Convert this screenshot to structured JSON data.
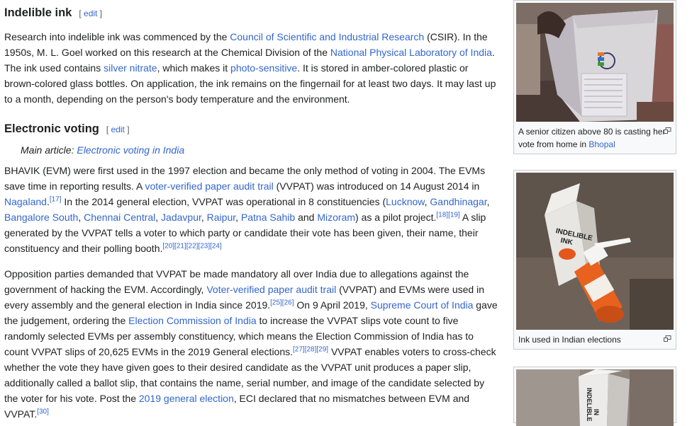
{
  "sections": {
    "ink": {
      "heading": "Indelible ink",
      "edit_open": "[ ",
      "edit_label": "edit",
      "edit_close": " ]",
      "p1": {
        "t1": "Research into indelible ink was commenced by the ",
        "l1": "Council of Scientific and Industrial Research",
        "t2": " (CSIR). In the 1950s, M. L. Goel worked on this research at the Chemical Division of the ",
        "l2": "National Physical Laboratory of India",
        "t3": ". The ink used contains ",
        "l3": "silver nitrate",
        "t4": ", which makes it ",
        "l4": "photo-sensitive",
        "t5": ". It is stored in amber-colored plastic or brown-colored glass bottles. On application, the ink remains on the fingernail for at least two days. It may last up to a month, depending on the person's body temperature and the environment."
      }
    },
    "evoting": {
      "heading": "Electronic voting",
      "edit_open": "[ ",
      "edit_label": "edit",
      "edit_close": " ]",
      "main_article_prefix": "Main article: ",
      "main_article_link": "Electronic voting in India",
      "p1": {
        "t1": "BHAVIK (EVM) were first used in the 1997 election and became the only method of voting in 2004. The EVMs save time in reporting results. A ",
        "l1": "voter-verified paper audit trail",
        "t2": " (VVPAT) was introduced on 14 August 2014 in ",
        "l2": "Nagaland",
        "ref1": "[17]",
        "t3": " In the 2014 general election, VVPAT was operational in 8 constituencies (",
        "c1": "Lucknow",
        "c2": "Gandhinagar",
        "c3": "Bangalore South",
        "c4": "Chennai Central",
        "c5": "Jadavpur",
        "c6": "Raipur",
        "c7": "Patna Sahib",
        "and": " and ",
        "c8": "Mizoram",
        "t4": ") as a pilot project.",
        "ref2": "[18][19]",
        "t5": " A slip generated by the VVPAT tells a voter to which party or candidate their vote has been given, their name, their constituency and their polling booth.",
        "ref3": "[20][21][22][23][24]"
      },
      "p2": {
        "t1": "Opposition parties demanded that VVPAT be made mandatory all over India due to allegations against the government of hacking the EVM. Accordingly, ",
        "l1": "Voter-verified paper audit trail",
        "t2": " (VVPAT) and EVMs were used in every assembly and the general election in India since 2019.",
        "ref1": "[25][26]",
        "t3": " On 9 April 2019, ",
        "l2": "Supreme Court of India",
        "t4": " gave the judgement, ordering the ",
        "l3": "Election Commission of India",
        "t5": " to increase the VVPAT slips vote count to five randomly selected EVMs per assembly constituency, which means the Election Commission of India has to count VVPAT slips of 20,625 EVMs in the 2019 General elections.",
        "ref2": "[27][28][29]",
        "t6": " VVPAT enables voters to cross-check whether the vote they have given goes to their desired candidate as the VVPAT unit produces a paper slip, additionally called a ballot slip, that contains the name, serial number, and image of the candidate selected by the voter for his vote. Post the ",
        "l4": "2019 general election",
        "t7": ", ECI declared that no mismatches between EVM and VVPAT.",
        "ref3": "[30]"
      }
    }
  },
  "figures": [
    {
      "caption_text": "A senior citizen above 80 is casting her vote from home in ",
      "caption_link": "Bhopal"
    },
    {
      "caption_text": "Ink used in Indian elections",
      "box_label_1": "INDELIBLE",
      "box_label_2": "INK"
    },
    {
      "box_label_1": "INDELIBLE",
      "box_label_2": "IN"
    }
  ],
  "colors": {
    "link": "#3366cc",
    "text": "#202122",
    "thumb_bg": "#f8f9fa",
    "thumb_border": "#c8ccd1"
  }
}
